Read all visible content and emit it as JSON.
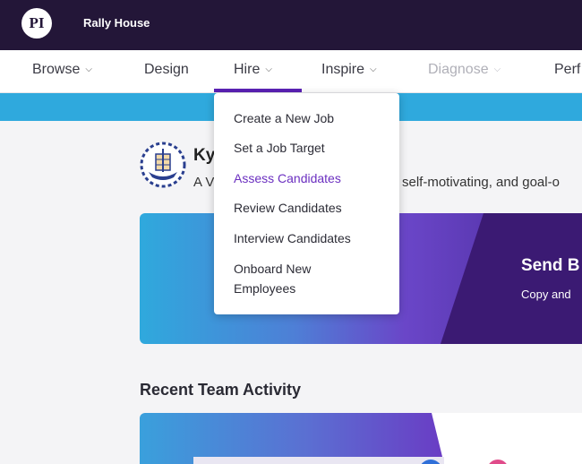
{
  "app": {
    "logo_text": "PI",
    "company": "Rally House"
  },
  "nav": {
    "items": [
      {
        "label": "Browse",
        "chevron": "⌵"
      },
      {
        "label": "Design"
      },
      {
        "label": "Hire",
        "chevron": "⌵",
        "active": true
      },
      {
        "label": "Inspire",
        "chevron": "⌵"
      },
      {
        "label": "Diagnose",
        "chevron": "⌵",
        "disabled": true
      },
      {
        "label": "Perf"
      }
    ]
  },
  "hire_menu": {
    "items": [
      {
        "label": "Create a New Job"
      },
      {
        "label": "Set a Job Target"
      },
      {
        "label": "Assess Candidates",
        "active": true
      },
      {
        "label": "Review Candidates"
      },
      {
        "label": "Interview Candidates"
      },
      {
        "label": "Onboard New Employees"
      }
    ]
  },
  "profile": {
    "name": "Ky",
    "description_start": "A V",
    "description_visible_end": "self-motivating, and goal-o",
    "icon": "viking-ship-icon"
  },
  "banner": {
    "title": "Send B",
    "subtitle": "Copy and"
  },
  "recent": {
    "title": "Recent Team Activity"
  },
  "colors": {
    "topbar": "#231638",
    "accent_purple": "#5b21b6",
    "active_menu": "#6b2fc0",
    "strip_blue": "#2fa9dd"
  }
}
